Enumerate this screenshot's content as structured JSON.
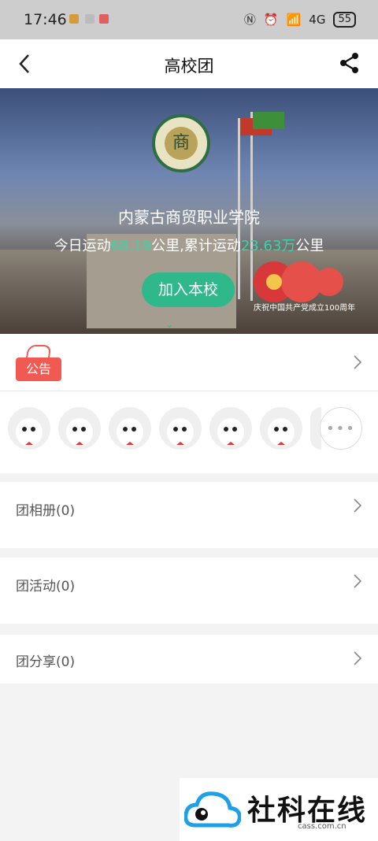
{
  "status_bar": {
    "time": "17:46",
    "network": "4G",
    "battery": "55"
  },
  "header": {
    "title": "高校团"
  },
  "hero": {
    "school_name": "内蒙古商贸职业学院",
    "stats_prefix": "今日运动",
    "today_value": "68.19",
    "stats_mid": "公里,累计运动",
    "total_value": "23.63万",
    "stats_suffix": "公里",
    "join_label": "加入本校",
    "banner_text": "庆祝中国共产党成立100周年"
  },
  "notice": {
    "tag": "公告"
  },
  "members": {
    "more": "•••"
  },
  "sections": [
    {
      "label": "团相册(0)"
    },
    {
      "label": "团活动(0)"
    },
    {
      "label": "团分享(0)"
    }
  ],
  "watermark": {
    "brand": "社科在线",
    "domain": "cass.com.cn"
  },
  "colors": {
    "accent": "#2fb98a",
    "stats_highlight": "#33d6a6",
    "notice_tag": "#f15a52"
  }
}
